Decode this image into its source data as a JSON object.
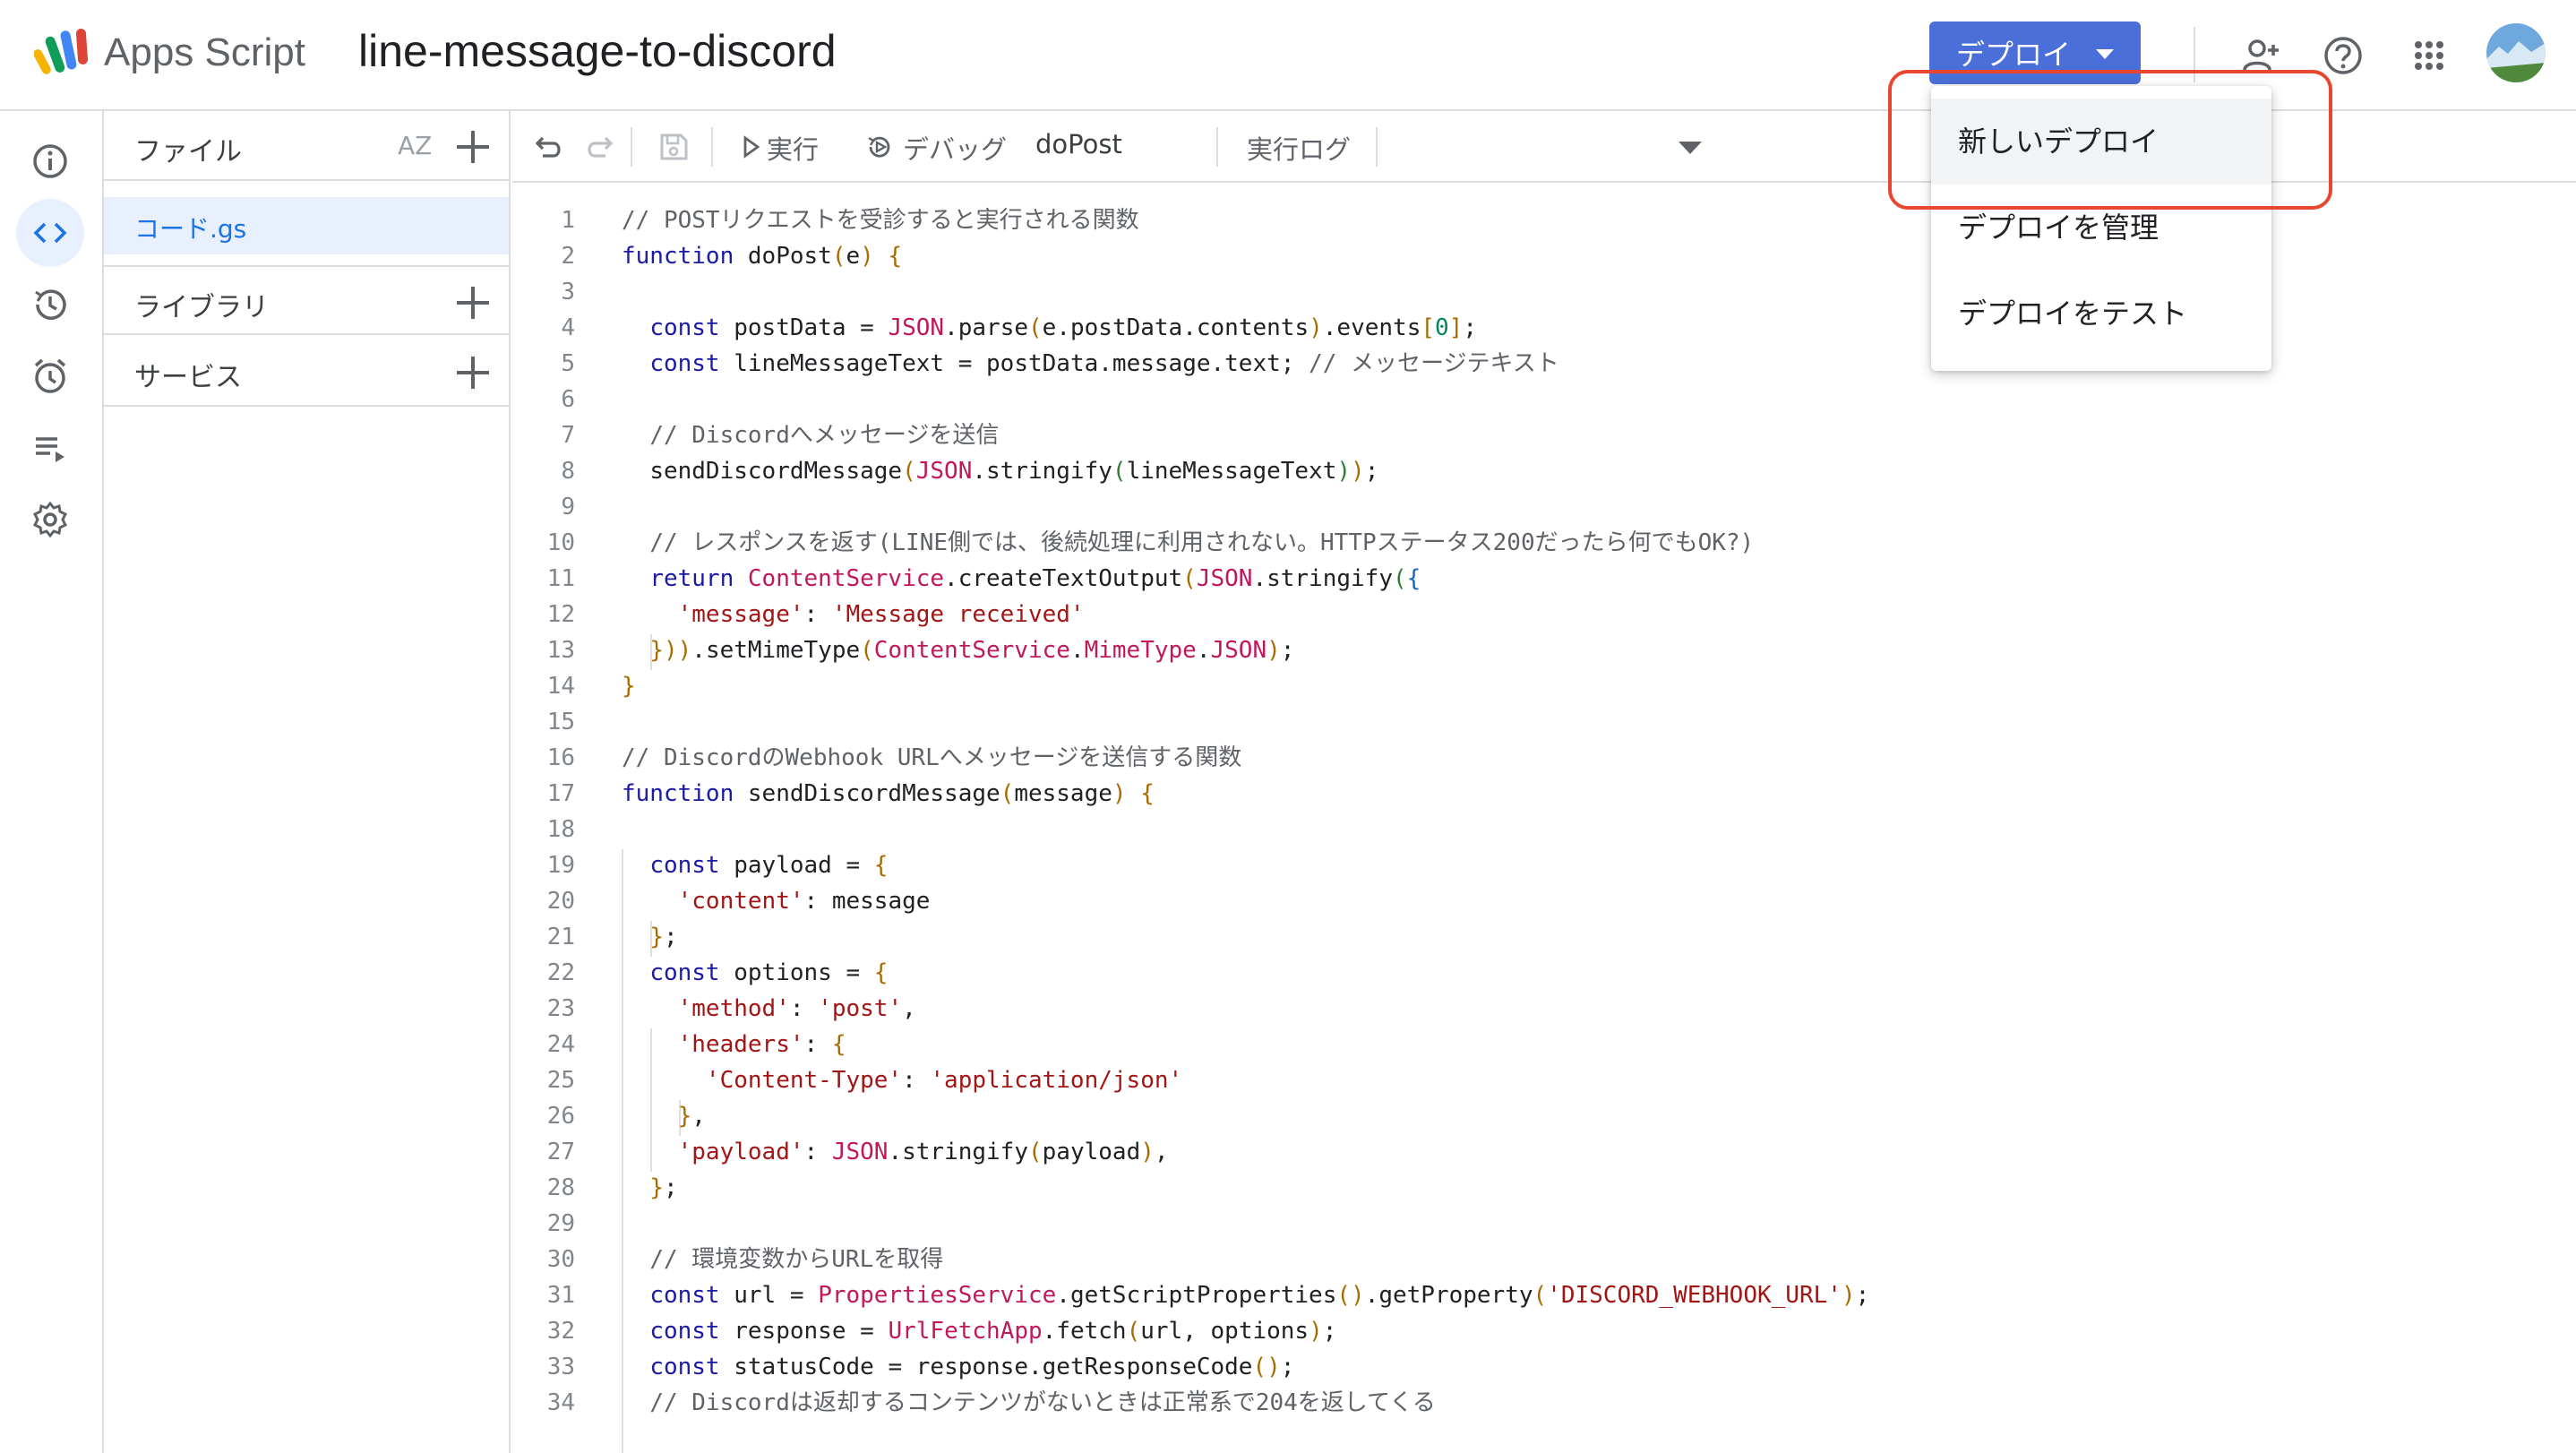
{
  "app": {
    "name": "Apps Script",
    "project_title": "line-message-to-discord"
  },
  "header": {
    "deploy_label": "デプロイ",
    "icons": [
      "add-person-icon",
      "help-icon",
      "apps-grid-icon"
    ],
    "accent_color": "#4a6fd8"
  },
  "rail": {
    "items": [
      "info-icon",
      "code-icon",
      "history-icon",
      "alarm-icon",
      "executions-icon",
      "gear-icon"
    ],
    "active": "code-icon"
  },
  "files_panel": {
    "files_label": "ファイル",
    "sort_label": "AZ",
    "file_name": "コード.gs",
    "libraries_label": "ライブラリ",
    "services_label": "サービス"
  },
  "toolbar": {
    "run_label": "実行",
    "debug_label": "デバッグ",
    "function_select": "doPost",
    "log_label": "実行ログ"
  },
  "deploy_menu": {
    "items": [
      "新しいデプロイ",
      "デプロイを管理",
      "デプロイをテスト"
    ],
    "highlight_color": "#e8462e"
  },
  "code_lines": [
    {
      "n": "1",
      "t": "// POSTリクエストを受診すると実行される関数"
    },
    {
      "n": "2",
      "t": "function doPost(e) {"
    },
    {
      "n": "3",
      "t": ""
    },
    {
      "n": "4",
      "t": "  const postData = JSON.parse(e.postData.contents).events[0];"
    },
    {
      "n": "5",
      "t": "  const lineMessageText = postData.message.text; // メッセージテキスト"
    },
    {
      "n": "6",
      "t": ""
    },
    {
      "n": "7",
      "t": "  // Discordへメッセージを送信"
    },
    {
      "n": "8",
      "t": "  sendDiscordMessage(JSON.stringify(lineMessageText));"
    },
    {
      "n": "9",
      "t": ""
    },
    {
      "n": "10",
      "t": "  // レスポンスを返す(LINE側では、後続処理に利用されない。HTTPステータス200だったら何でもOK?)"
    },
    {
      "n": "11",
      "t": "  return ContentService.createTextOutput(JSON.stringify({"
    },
    {
      "n": "12",
      "t": "    'message': 'Message received'"
    },
    {
      "n": "13",
      "t": "  })).setMimeType(ContentService.MimeType.JSON);"
    },
    {
      "n": "14",
      "t": "}"
    },
    {
      "n": "15",
      "t": ""
    },
    {
      "n": "16",
      "t": "// DiscordのWebhook URLへメッセージを送信する関数"
    },
    {
      "n": "17",
      "t": "function sendDiscordMessage(message) {"
    },
    {
      "n": "18",
      "t": ""
    },
    {
      "n": "19",
      "t": "  const payload = {"
    },
    {
      "n": "20",
      "t": "    'content': message"
    },
    {
      "n": "21",
      "t": "  };"
    },
    {
      "n": "22",
      "t": "  const options = {"
    },
    {
      "n": "23",
      "t": "    'method': 'post',"
    },
    {
      "n": "24",
      "t": "    'headers': {"
    },
    {
      "n": "25",
      "t": "      'Content-Type': 'application/json'"
    },
    {
      "n": "26",
      "t": "    },"
    },
    {
      "n": "27",
      "t": "    'payload': JSON.stringify(payload),"
    },
    {
      "n": "28",
      "t": "  };"
    },
    {
      "n": "29",
      "t": ""
    },
    {
      "n": "30",
      "t": "  // 環境変数からURLを取得"
    },
    {
      "n": "31",
      "t": "  const url = PropertiesService.getScriptProperties().getProperty('DISCORD_WEBHOOK_URL');"
    },
    {
      "n": "32",
      "t": "  const response = UrlFetchApp.fetch(url, options);"
    },
    {
      "n": "33",
      "t": "  const statusCode = response.getResponseCode();"
    },
    {
      "n": "34",
      "t": "  // Discordは返却するコンテンツがないときは正常系で204を返してくる"
    }
  ]
}
